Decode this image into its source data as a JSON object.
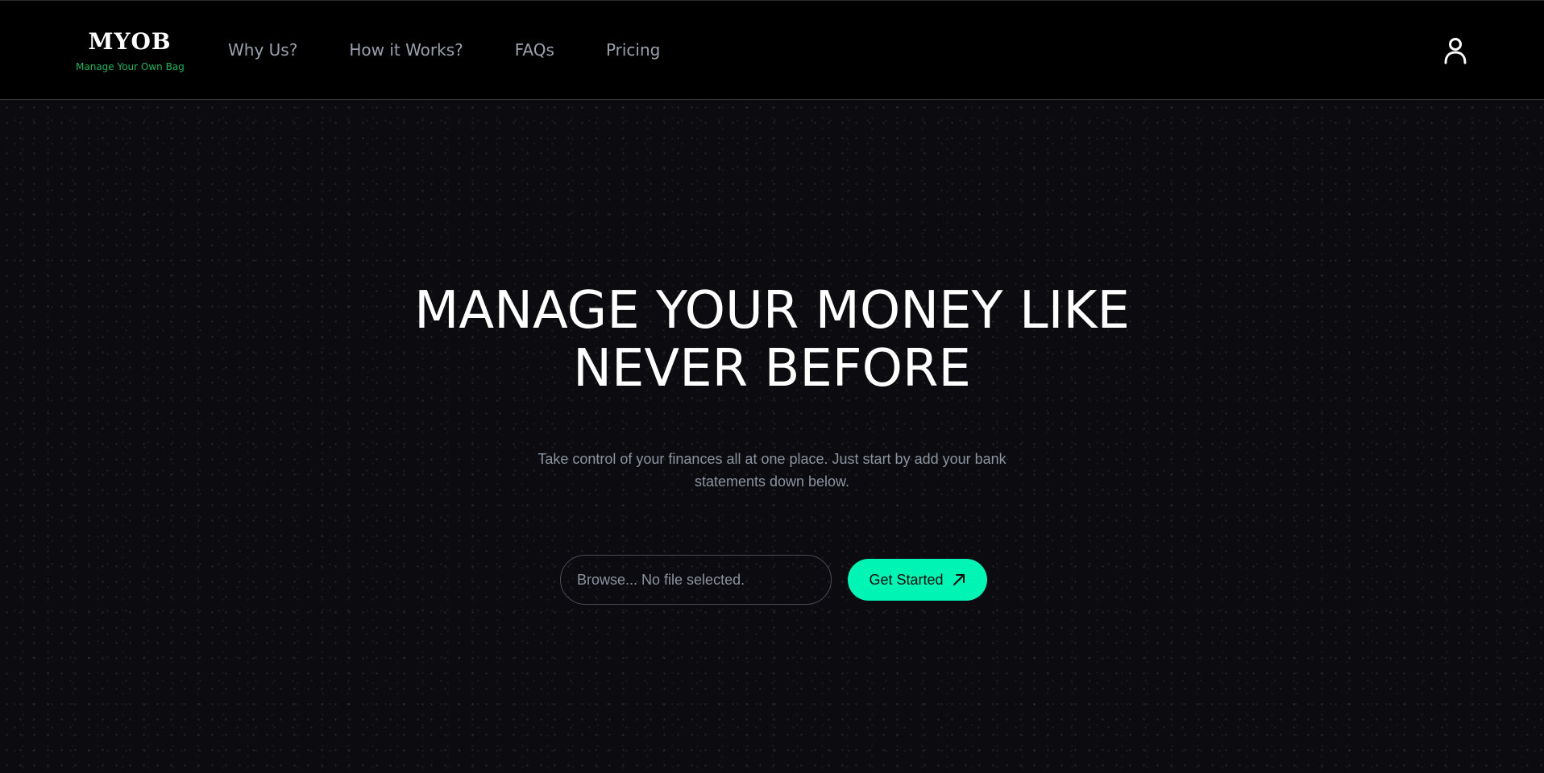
{
  "brand": {
    "name": "MYOB",
    "tagline": "Manage Your Own Bag",
    "tagline_color": "#21b45c"
  },
  "nav": {
    "items": [
      {
        "label": "Why Us?"
      },
      {
        "label": "How it Works?"
      },
      {
        "label": "FAQs"
      },
      {
        "label": "Pricing"
      }
    ],
    "user_icon": "user-icon"
  },
  "hero": {
    "title_line1": "MANAGE YOUR MONEY LIKE",
    "title_line2": "NEVER BEFORE",
    "subtitle": "Take control of your finances all at one place. Just start by add your bank statements down below.",
    "file_input_text": "Browse... No file selected.",
    "cta_label": "Get Started",
    "cta_icon": "arrow-up-right-icon",
    "accent_color": "#00f5b4"
  }
}
